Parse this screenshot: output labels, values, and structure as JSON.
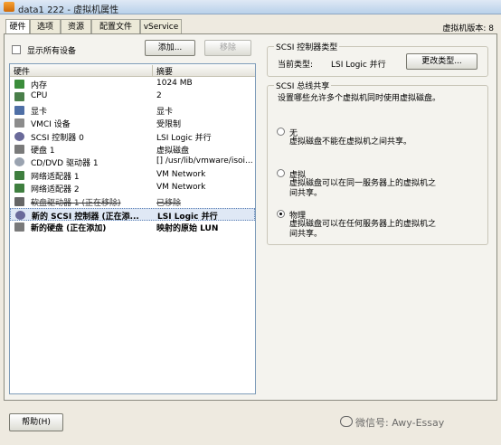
{
  "window": {
    "title": "data1 222 - 虚拟机属性"
  },
  "tabs": [
    "硬件",
    "选项",
    "资源",
    "配置文件",
    "vService"
  ],
  "version_label": "虚拟机版本: 8",
  "show_all_devices": {
    "label": "显示所有设备",
    "checked": false
  },
  "buttons": {
    "add": "添加...",
    "remove": "移除",
    "change_type": "更改类型...",
    "help": "帮助(H)"
  },
  "hardware_list": {
    "columns": [
      "硬件",
      "摘要"
    ],
    "rows": [
      {
        "name": "内存",
        "summary": "1024 MB",
        "icon": "memory-icon"
      },
      {
        "name": "CPU",
        "summary": "2",
        "icon": "cpu-icon"
      },
      {
        "name": "显卡",
        "summary": "显卡",
        "icon": "video-card-icon"
      },
      {
        "name": "VMCI 设备",
        "summary": "受限制",
        "icon": "vmci-icon"
      },
      {
        "name": "SCSI 控制器 0",
        "summary": "LSI Logic 并行",
        "icon": "scsi-icon"
      },
      {
        "name": "硬盘 1",
        "summary": "虚拟磁盘",
        "icon": "disk-icon"
      },
      {
        "name": "CD/DVD 驱动器 1",
        "summary": "[] /usr/lib/vmware/isoi...",
        "icon": "cdrom-icon"
      },
      {
        "name": "网络适配器 1",
        "summary": "VM Network",
        "icon": "network-icon"
      },
      {
        "name": "网络适配器 2",
        "summary": "VM Network",
        "icon": "network-icon"
      },
      {
        "name": "软盘驱动器 1 (正在移除)",
        "summary": "已移除",
        "icon": "floppy-icon"
      },
      {
        "name": "新的 SCSI 控制器 (正在添...",
        "summary": "LSI Logic 并行",
        "icon": "scsi-icon"
      },
      {
        "name": "新的硬盘 (正在添加)",
        "summary": "映射的原始 LUN",
        "icon": "disk-icon"
      }
    ]
  },
  "controller_type": {
    "legend": "SCSI 控制器类型",
    "current_label": "当前类型:",
    "current_value": "LSI Logic 并行"
  },
  "bus_sharing": {
    "legend": "SCSI 总线共享",
    "description": "设置哪些允许多个虚拟机同时使用虚拟磁盘。",
    "options": [
      {
        "title": "无",
        "desc": "虚拟磁盘不能在虚拟机之间共享。",
        "selected": false
      },
      {
        "title": "虚拟",
        "desc": "虚拟磁盘可以在同一服务器上的虚拟机之间共享。",
        "selected": false
      },
      {
        "title": "物理",
        "desc": "虚拟磁盘可以在任何服务器上的虚拟机之间共享。",
        "selected": true
      }
    ]
  },
  "watermark": "微信号: Awy-Essay",
  "colors": {
    "title_bar": "#b9d1ea",
    "selected_row": "#dfe8f5",
    "panel": "#f4f3ee"
  }
}
